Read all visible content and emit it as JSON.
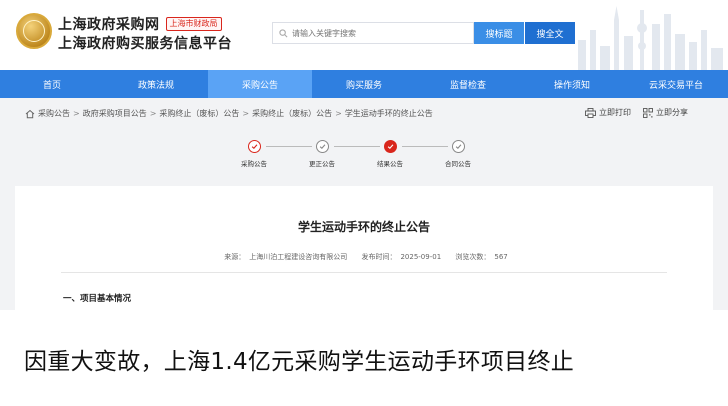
{
  "header": {
    "site_name_line1": "上海政府采购网",
    "badge": "上海市财政局",
    "site_name_line2": "上海政府购买服务信息平台",
    "search_placeholder": "请输入关键字搜索",
    "search_title_button": "搜标题",
    "search_full_button": "搜全文"
  },
  "nav": {
    "items": [
      {
        "label": "首页"
      },
      {
        "label": "政策法规"
      },
      {
        "label": "采购公告"
      },
      {
        "label": "购买服务"
      },
      {
        "label": "监督检查"
      },
      {
        "label": "操作须知"
      },
      {
        "label": "云采交易平台"
      }
    ],
    "active_index": 2
  },
  "breadcrumb": {
    "items": [
      "采购公告",
      "政府采购项目公告",
      "采购终止（废标）公告",
      "采购终止（废标）公告",
      "学生运动手环的终止公告"
    ],
    "separator": ">"
  },
  "tools": {
    "print": "立即打印",
    "share": "立即分享"
  },
  "steps": [
    {
      "label": "采购公告",
      "state": "done"
    },
    {
      "label": "更正公告",
      "state": "todo"
    },
    {
      "label": "结果公告",
      "state": "current"
    },
    {
      "label": "合同公告",
      "state": "todo"
    }
  ],
  "document": {
    "title": "学生运动手环的终止公告",
    "source_label": "来源：",
    "source": "上海川泊工程建设咨询有限公司",
    "published_label": "发布时间：",
    "published": "2025-09-01",
    "views_label": "浏览次数：",
    "views": "567",
    "section1": "一、项目基本情况"
  },
  "caption": {
    "text": "因重大变故，上海1.4亿元采购学生运动手环项目终止"
  },
  "colors": {
    "nav_bg": "#2f7fe0",
    "nav_active": "#5aa3f5",
    "accent_red": "#d9261c",
    "button_blue": "#3a8ee6"
  }
}
